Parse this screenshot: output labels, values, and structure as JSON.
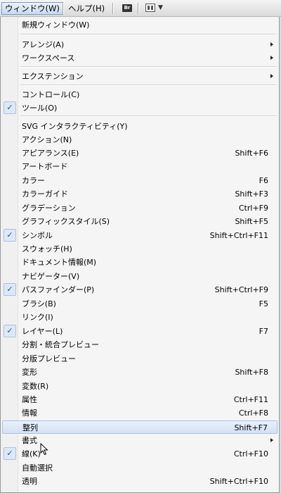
{
  "menubar": {
    "window_label": "ウィンドウ(W)",
    "help_label": "ヘルプ(H)",
    "bridge_icon_text": "Br",
    "icons": [
      "bridge-icon",
      "workspace-layout-icon",
      "chevron-down-icon"
    ]
  },
  "menu": {
    "items": [
      {
        "label": "新規ウィンドウ(W)",
        "shortcut": "",
        "checked": false,
        "submenu": false
      },
      {
        "label": "アレンジ(A)",
        "shortcut": "",
        "checked": false,
        "submenu": true
      },
      {
        "label": "ワークスペース",
        "shortcut": "",
        "checked": false,
        "submenu": true
      },
      {
        "label": "エクステンション",
        "shortcut": "",
        "checked": false,
        "submenu": true
      },
      {
        "label": "コントロール(C)",
        "shortcut": "",
        "checked": false,
        "submenu": false
      },
      {
        "label": "ツール(O)",
        "shortcut": "",
        "checked": true,
        "submenu": false
      },
      {
        "label": "SVG インタラクティビティ(Y)",
        "shortcut": "",
        "checked": false,
        "submenu": false
      },
      {
        "label": "アクション(N)",
        "shortcut": "",
        "checked": false,
        "submenu": false
      },
      {
        "label": "アピアランス(E)",
        "shortcut": "Shift+F6",
        "checked": false,
        "submenu": false
      },
      {
        "label": "アートボード",
        "shortcut": "",
        "checked": false,
        "submenu": false
      },
      {
        "label": "カラー",
        "shortcut": "F6",
        "checked": false,
        "submenu": false
      },
      {
        "label": "カラーガイド",
        "shortcut": "Shift+F3",
        "checked": false,
        "submenu": false
      },
      {
        "label": "グラデーション",
        "shortcut": "Ctrl+F9",
        "checked": false,
        "submenu": false
      },
      {
        "label": "グラフィックスタイル(S)",
        "shortcut": "Shift+F5",
        "checked": false,
        "submenu": false
      },
      {
        "label": "シンボル",
        "shortcut": "Shift+Ctrl+F11",
        "checked": true,
        "submenu": false
      },
      {
        "label": "スウォッチ(H)",
        "shortcut": "",
        "checked": false,
        "submenu": false
      },
      {
        "label": "ドキュメント情報(M)",
        "shortcut": "",
        "checked": false,
        "submenu": false
      },
      {
        "label": "ナビゲーター(V)",
        "shortcut": "",
        "checked": false,
        "submenu": false
      },
      {
        "label": "パスファインダー(P)",
        "shortcut": "Shift+Ctrl+F9",
        "checked": true,
        "submenu": false
      },
      {
        "label": "ブラシ(B)",
        "shortcut": "F5",
        "checked": false,
        "submenu": false
      },
      {
        "label": "リンク(I)",
        "shortcut": "",
        "checked": false,
        "submenu": false
      },
      {
        "label": "レイヤー(L)",
        "shortcut": "F7",
        "checked": true,
        "submenu": false
      },
      {
        "label": "分割・統合プレビュー",
        "shortcut": "",
        "checked": false,
        "submenu": false
      },
      {
        "label": "分版プレビュー",
        "shortcut": "",
        "checked": false,
        "submenu": false
      },
      {
        "label": "変形",
        "shortcut": "Shift+F8",
        "checked": false,
        "submenu": false
      },
      {
        "label": "変数(R)",
        "shortcut": "",
        "checked": false,
        "submenu": false
      },
      {
        "label": "属性",
        "shortcut": "Ctrl+F11",
        "checked": false,
        "submenu": false
      },
      {
        "label": "情報",
        "shortcut": "Ctrl+F8",
        "checked": false,
        "submenu": false
      },
      {
        "label": "整列",
        "shortcut": "Shift+F7",
        "checked": false,
        "submenu": false,
        "highlighted": true
      },
      {
        "label": "書式",
        "shortcut": "",
        "checked": false,
        "submenu": true
      },
      {
        "label": "線(K)",
        "shortcut": "Ctrl+F10",
        "checked": true,
        "submenu": false
      },
      {
        "label": "自動選択",
        "shortcut": "",
        "checked": false,
        "submenu": false
      },
      {
        "label": "透明",
        "shortcut": "Shift+Ctrl+F10",
        "checked": false,
        "submenu": false
      }
    ]
  },
  "colors": {
    "highlight_bg": "#d3e1f5",
    "highlight_border": "#a8c1e8",
    "check_color": "#1d4f9c"
  }
}
